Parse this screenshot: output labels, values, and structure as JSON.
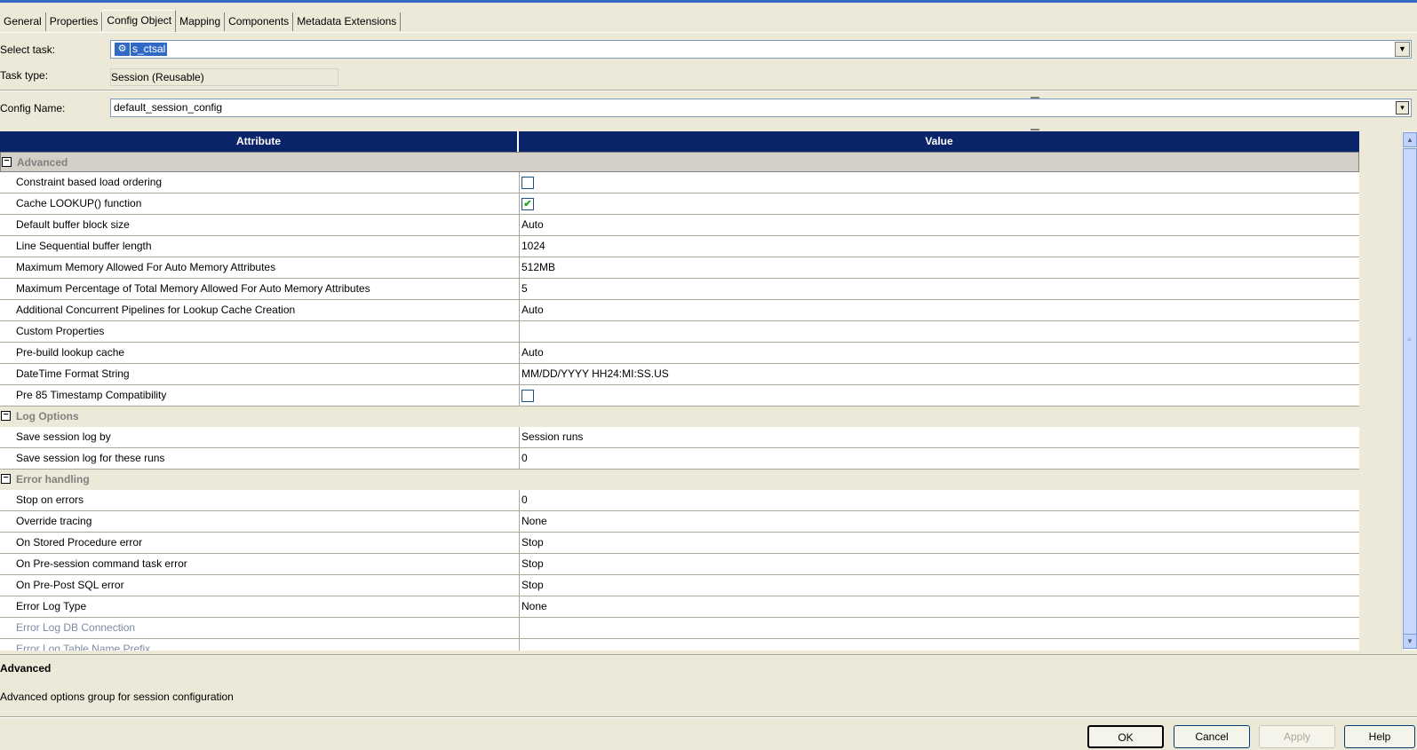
{
  "tabs": [
    "General",
    "Properties",
    "Config Object",
    "Mapping",
    "Components",
    "Metadata Extensions"
  ],
  "active_tab": "Config Object",
  "form": {
    "select_task_label": "Select task:",
    "select_task_value": "s_ctsal",
    "task_type_label": "Task type:",
    "task_type_value": "Session (Reusable)",
    "config_name_label": "Config Name:",
    "config_name_value": "default_session_config"
  },
  "grid": {
    "col_attribute": "Attribute",
    "col_value": "Value",
    "groups": [
      {
        "name": "Advanced",
        "rows": [
          {
            "attr": "Constraint based load ordering",
            "type": "checkbox",
            "checked": false
          },
          {
            "attr": "Cache LOOKUP() function",
            "type": "checkbox",
            "checked": true
          },
          {
            "attr": "Default buffer block size",
            "value": "Auto"
          },
          {
            "attr": "Line Sequential buffer length",
            "value": "1024"
          },
          {
            "attr": "Maximum Memory Allowed For Auto Memory Attributes",
            "value": "512MB"
          },
          {
            "attr": "Maximum Percentage of Total Memory Allowed For Auto Memory Attributes",
            "value": "5"
          },
          {
            "attr": "Additional Concurrent Pipelines for Lookup Cache Creation",
            "value": "Auto"
          },
          {
            "attr": "Custom Properties",
            "value": ""
          },
          {
            "attr": "Pre-build lookup cache",
            "value": "Auto"
          },
          {
            "attr": "DateTime Format String",
            "value": "MM/DD/YYYY HH24:MI:SS.US"
          },
          {
            "attr": "Pre 85 Timestamp Compatibility",
            "type": "checkbox",
            "checked": false
          }
        ]
      },
      {
        "name": "Log Options",
        "rows": [
          {
            "attr": "Save session log by",
            "value": "Session runs"
          },
          {
            "attr": "Save session log for these runs",
            "value": "0"
          }
        ]
      },
      {
        "name": "Error handling",
        "rows": [
          {
            "attr": "Stop on errors",
            "value": "0"
          },
          {
            "attr": "Override tracing",
            "value": "None"
          },
          {
            "attr": "On Stored Procedure error",
            "value": "Stop"
          },
          {
            "attr": "On Pre-session command task error",
            "value": "Stop"
          },
          {
            "attr": "On Pre-Post SQL error",
            "value": "Stop"
          },
          {
            "attr": "Error Log Type",
            "value": "None"
          },
          {
            "attr": "Error Log DB Connection",
            "value": "",
            "disabled": true
          },
          {
            "attr": "Error Log Table Name Prefix",
            "value": "",
            "disabled": true
          }
        ]
      }
    ]
  },
  "description": {
    "title": "Advanced",
    "text": "Advanced options group for session configuration"
  },
  "buttons": {
    "ok": "OK",
    "cancel": "Cancel",
    "apply": "Apply",
    "help": "Help"
  },
  "icons": {
    "task": "session-icon",
    "dropdown": "chevron-down-icon",
    "browse": "browse-icon",
    "collapse": "minus-box-icon"
  }
}
